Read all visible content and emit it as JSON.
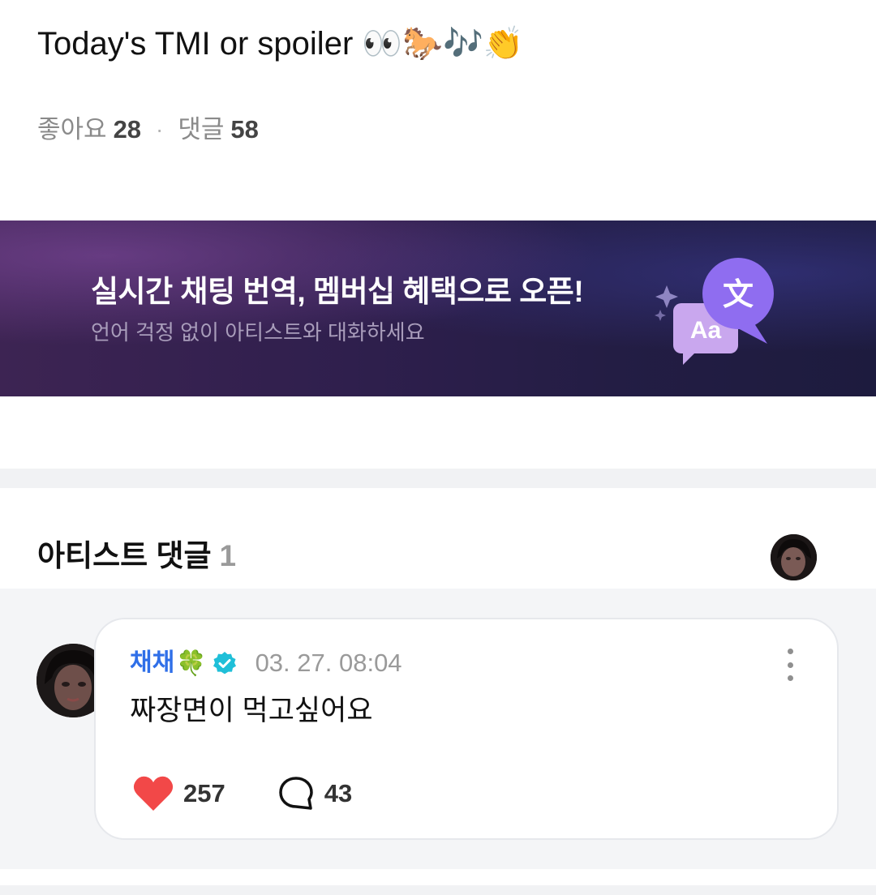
{
  "post": {
    "title": "Today's TMI or spoiler 👀🐎🎶👏",
    "likes_label": "좋아요",
    "likes_count": "28",
    "separator": "·",
    "comments_label": "댓글",
    "comments_count": "58"
  },
  "banner": {
    "title": "실시간 채팅 번역, 멤버십 혜택으로 오픈!",
    "subtitle": "언어 걱정 없이 아티스트와 대화하세요",
    "art_glyph_main": "文",
    "art_glyph_sub": "Aa",
    "icon": "translate-bubbles-icon",
    "colors": {
      "bg_start": "#3d2453",
      "bg_end": "#1d1b3e",
      "bubble_main": "#8f6df0",
      "bubble_sub": "#c9a7ee"
    }
  },
  "artist_comments": {
    "title": "아티스트 댓글",
    "count": "1",
    "comments": [
      {
        "author": "채채",
        "author_emoji": "🍀",
        "verified_icon": "verified-badge-icon",
        "time": "03. 27. 08:04",
        "text": "짜장면이 먹고싶어요",
        "likes": "257",
        "replies": "43"
      }
    ]
  },
  "colors": {
    "accent_blue": "#2f6fe8",
    "verified_teal": "#1fbfd8",
    "heart_red": "#f24848",
    "muted_text": "#9a9a9a",
    "section_bg": "#f4f5f7"
  }
}
